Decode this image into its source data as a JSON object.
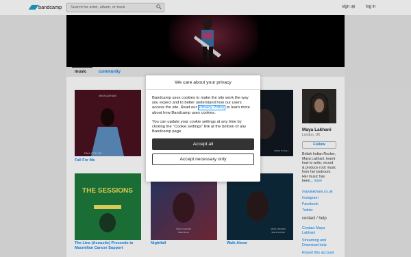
{
  "topbar": {
    "logo": "bandcamp",
    "search_placeholder": "Search for artist, album, or track",
    "signup": "sign up",
    "login": "log in"
  },
  "tabs": {
    "music": "music",
    "community": "community"
  },
  "albums": [
    {
      "title": "Fall For Me",
      "cover_text": "FALL FOR ME",
      "cover_artist": "MAYA LAKHANI"
    },
    {
      "title": "",
      "cover_text": "",
      "cover_artist": ""
    },
    {
      "title": "",
      "cover_text": "MADE TO FALL",
      "cover_artist": ""
    },
    {
      "title": "The Line (Acoustic) Proceeds to Macmillan Cancer Support",
      "cover_text": "THE SESSIONS",
      "cover_artist": ""
    },
    {
      "title": "Nightfall",
      "cover_text": "NIGHTFALL",
      "cover_artist": "MAYA LAKHANI"
    },
    {
      "title": "Walk Alone",
      "cover_text": "WALK ALONE",
      "cover_artist": "MAYA LAKHANI"
    }
  ],
  "sidebar": {
    "name": "Maya Lakhani",
    "location": "London, UK",
    "follow": "Follow",
    "bio": "British Indian Rocker, Maya Lakhani, learnt how to write, record & produce rock music from her bedroom. Her music has been...",
    "more": "more",
    "links": [
      "mayalakhani.co.uk",
      "Instagram",
      "Facebook",
      "Twitter"
    ],
    "contact_heading": "contact / help",
    "contact_links": [
      "Contact Maya Lakhani",
      "Streaming and Download help",
      "Report this account"
    ]
  },
  "modal": {
    "title": "We care about your privacy",
    "para1_a": "Bandcamp uses cookies to make the site work the way you expect and to better understand how our users access the site. Read our",
    "privacy_link": "Privacy Policy",
    "para1_b": "to learn more about how Bandcamp uses cookies.",
    "para2": "You can update your cookie settings at any time by clicking the \"Cookie settings\" link at the bottom of any Bandcamp page.",
    "accept_all": "Accept all",
    "accept_necessary": "Accept necessary only"
  },
  "colors": {
    "link": "#0687f5",
    "logo": "#1da0c3",
    "dark_button": "#333333"
  }
}
